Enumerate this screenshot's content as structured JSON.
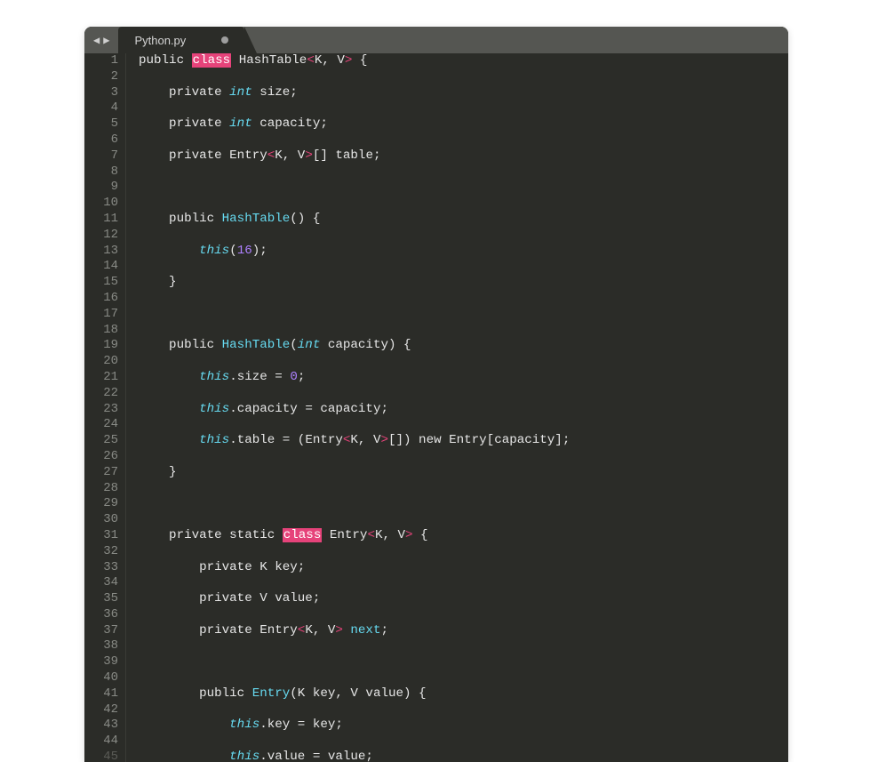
{
  "tab": {
    "filename": "Python.py",
    "dirty": true
  },
  "gutter": {
    "start": 1,
    "end": 45
  },
  "code": {
    "lines": [
      [
        {
          "t": "default",
          "v": "public "
        },
        {
          "t": "keyword-hl",
          "v": "class"
        },
        {
          "t": "default",
          "v": " HashTable"
        },
        {
          "t": "angle",
          "v": "<"
        },
        {
          "t": "default",
          "v": "K, V"
        },
        {
          "t": "angle",
          "v": ">"
        },
        {
          "t": "default",
          "v": " {"
        }
      ],
      [],
      [
        {
          "t": "default",
          "v": "    private "
        },
        {
          "t": "type",
          "v": "int"
        },
        {
          "t": "default",
          "v": " size;"
        }
      ],
      [],
      [
        {
          "t": "default",
          "v": "    private "
        },
        {
          "t": "type",
          "v": "int"
        },
        {
          "t": "default",
          "v": " capacity;"
        }
      ],
      [],
      [
        {
          "t": "default",
          "v": "    private Entry"
        },
        {
          "t": "angle",
          "v": "<"
        },
        {
          "t": "default",
          "v": "K, V"
        },
        {
          "t": "angle",
          "v": ">"
        },
        {
          "t": "default",
          "v": "[] table;"
        }
      ],
      [],
      [],
      [],
      [
        {
          "t": "default",
          "v": "    public "
        },
        {
          "t": "func",
          "v": "HashTable"
        },
        {
          "t": "default",
          "v": "() {"
        }
      ],
      [],
      [
        {
          "t": "default",
          "v": "        "
        },
        {
          "t": "this",
          "v": "this"
        },
        {
          "t": "default",
          "v": "("
        },
        {
          "t": "num",
          "v": "16"
        },
        {
          "t": "default",
          "v": ");"
        }
      ],
      [],
      [
        {
          "t": "default",
          "v": "    }"
        }
      ],
      [],
      [],
      [],
      [
        {
          "t": "default",
          "v": "    public "
        },
        {
          "t": "func",
          "v": "HashTable"
        },
        {
          "t": "default",
          "v": "("
        },
        {
          "t": "type",
          "v": "int"
        },
        {
          "t": "default",
          "v": " capacity) {"
        }
      ],
      [],
      [
        {
          "t": "default",
          "v": "        "
        },
        {
          "t": "this",
          "v": "this"
        },
        {
          "t": "default",
          "v": ".size = "
        },
        {
          "t": "num",
          "v": "0"
        },
        {
          "t": "default",
          "v": ";"
        }
      ],
      [],
      [
        {
          "t": "default",
          "v": "        "
        },
        {
          "t": "this",
          "v": "this"
        },
        {
          "t": "default",
          "v": ".capacity = capacity;"
        }
      ],
      [],
      [
        {
          "t": "default",
          "v": "        "
        },
        {
          "t": "this",
          "v": "this"
        },
        {
          "t": "default",
          "v": ".table = (Entry"
        },
        {
          "t": "angle",
          "v": "<"
        },
        {
          "t": "default",
          "v": "K, V"
        },
        {
          "t": "angle",
          "v": ">"
        },
        {
          "t": "default",
          "v": "[]) new Entry[capacity];"
        }
      ],
      [],
      [
        {
          "t": "default",
          "v": "    }"
        }
      ],
      [],
      [],
      [],
      [
        {
          "t": "default",
          "v": "    private static "
        },
        {
          "t": "keyword-hl",
          "v": "class"
        },
        {
          "t": "default",
          "v": " Entry"
        },
        {
          "t": "angle",
          "v": "<"
        },
        {
          "t": "default",
          "v": "K, V"
        },
        {
          "t": "angle",
          "v": ">"
        },
        {
          "t": "default",
          "v": " {"
        }
      ],
      [],
      [
        {
          "t": "default",
          "v": "        private K key;"
        }
      ],
      [],
      [
        {
          "t": "default",
          "v": "        private V value;"
        }
      ],
      [],
      [
        {
          "t": "default",
          "v": "        private Entry"
        },
        {
          "t": "angle",
          "v": "<"
        },
        {
          "t": "default",
          "v": "K, V"
        },
        {
          "t": "angle",
          "v": ">"
        },
        {
          "t": "default",
          "v": " "
        },
        {
          "t": "member",
          "v": "next"
        },
        {
          "t": "default",
          "v": ";"
        }
      ],
      [],
      [],
      [],
      [
        {
          "t": "default",
          "v": "        public "
        },
        {
          "t": "func",
          "v": "Entry"
        },
        {
          "t": "default",
          "v": "(K key, V value) {"
        }
      ],
      [],
      [
        {
          "t": "default",
          "v": "            "
        },
        {
          "t": "this",
          "v": "this"
        },
        {
          "t": "default",
          "v": ".key = key;"
        }
      ],
      [],
      [
        {
          "t": "default",
          "v": "            "
        },
        {
          "t": "this",
          "v": "this"
        },
        {
          "t": "default",
          "v": ".value = value;"
        }
      ]
    ]
  }
}
